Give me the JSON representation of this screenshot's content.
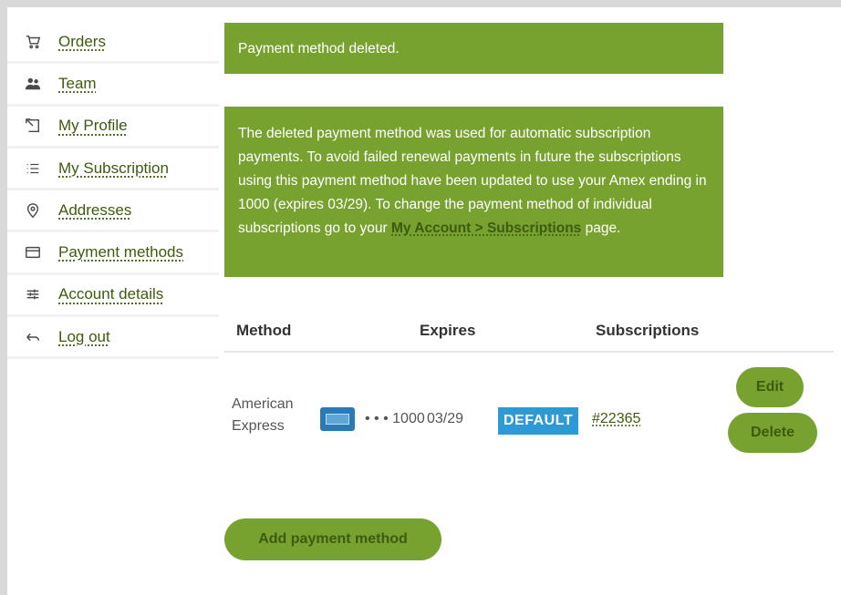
{
  "sidebar": {
    "items": [
      {
        "label": "Orders",
        "icon": "cart-icon"
      },
      {
        "label": "Team",
        "icon": "team-icon"
      },
      {
        "label": "My Profile",
        "icon": "profile-icon"
      },
      {
        "label": "My Subscription",
        "icon": "list-icon"
      },
      {
        "label": "Addresses",
        "icon": "location-pin-icon"
      },
      {
        "label": "Payment methods",
        "icon": "credit-card-icon"
      },
      {
        "label": "Account details",
        "icon": "sliders-icon"
      },
      {
        "label": "Log out",
        "icon": "logout-arrow-icon"
      }
    ]
  },
  "notices": {
    "deleted": "Payment method deleted.",
    "info_text": "The deleted payment method was used for automatic subscription payments. To avoid failed renewal payments in future the subscriptions using this payment method have been updated to use your Amex ending in 1000 (expires 03/29). To change the payment method of individual subscriptions go to your",
    "info_link": "My Account > Subscriptions",
    "info_suffix": "page."
  },
  "table": {
    "headers": {
      "method": "Method",
      "expires": "Expires",
      "subscriptions": "Subscriptions"
    },
    "row": {
      "method_name": "American Express",
      "card_masked": "• • • 1000",
      "expires": "03/29",
      "badge": "DEFAULT",
      "subscription": "#22365",
      "edit": "Edit",
      "delete": "Delete"
    }
  },
  "add_button": "Add payment method",
  "colors": {
    "accent": "#78a22f",
    "link": "#3d5a0f",
    "badge": "#2d9ad6"
  }
}
